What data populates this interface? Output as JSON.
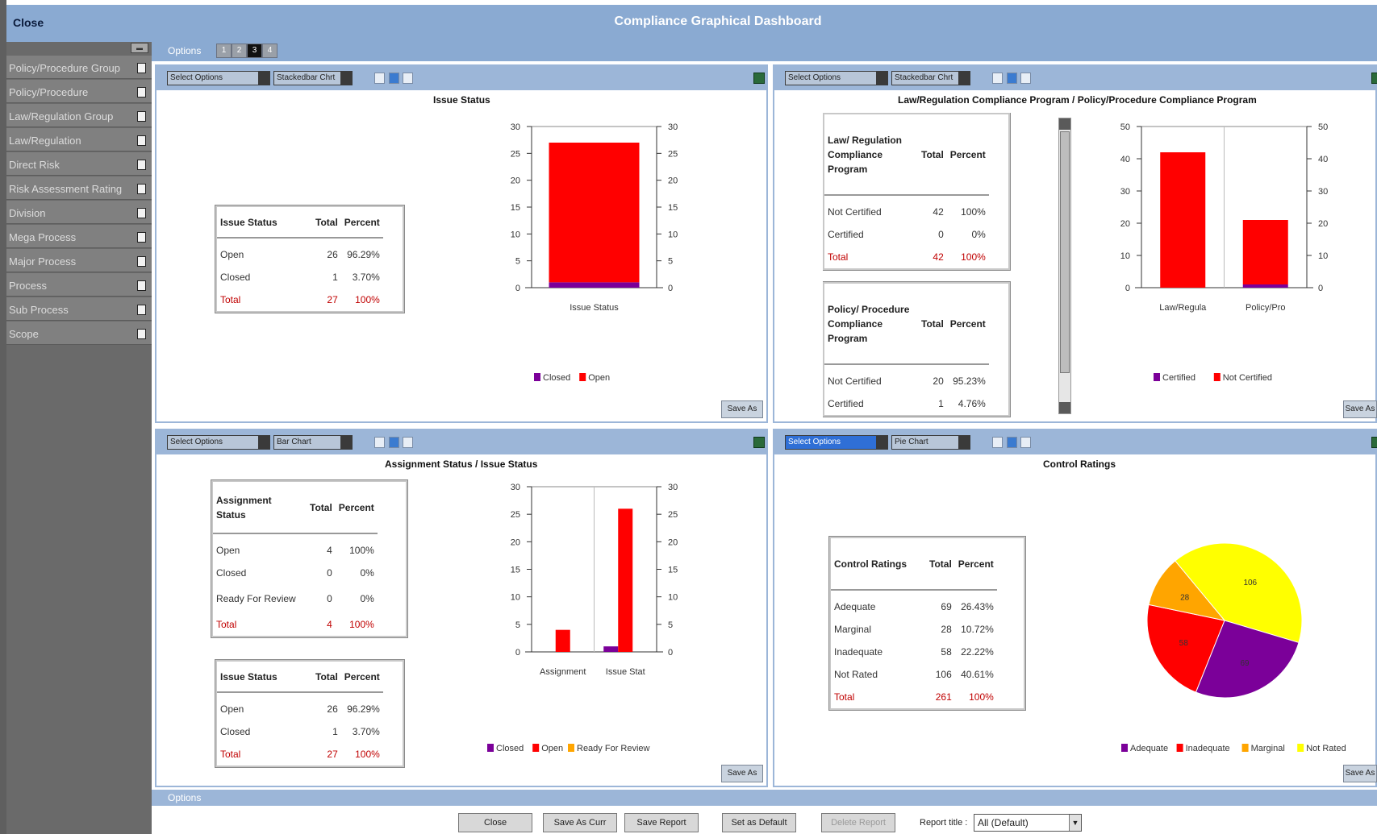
{
  "header": {
    "close_label": "Close",
    "title": "Compliance Graphical Dashboard",
    "options_label": "Options",
    "pages": [
      "1",
      "2",
      "3",
      "4"
    ],
    "active_page": "3"
  },
  "sidebar": {
    "items": [
      {
        "label": "Policy/Procedure Group"
      },
      {
        "label": "Policy/Procedure"
      },
      {
        "label": "Law/Regulation Group"
      },
      {
        "label": "Law/Regulation"
      },
      {
        "label": "Direct Risk"
      },
      {
        "label": "Risk Assessment Rating"
      },
      {
        "label": "Division"
      },
      {
        "label": "Mega Process"
      },
      {
        "label": "Major Process"
      },
      {
        "label": "Process"
      },
      {
        "label": "Sub Process"
      },
      {
        "label": "Scope"
      }
    ]
  },
  "panels": {
    "issue_status": {
      "select_options": "Select Options",
      "chart_type": "Stackedbar Chrt",
      "title": "Issue Status",
      "save_label": "Save As",
      "table": {
        "headers": [
          "Issue Status",
          "Total",
          "Percent"
        ],
        "rows": [
          [
            "Open",
            "26",
            "96.29%"
          ],
          [
            "Closed",
            "1",
            "3.70%"
          ]
        ],
        "total": [
          "Total",
          "27",
          "100%"
        ]
      }
    },
    "law_policy": {
      "select_options": "Select Options",
      "chart_type": "Stackedbar Chrt",
      "title": "Law/Regulation Compliance Program / Policy/Procedure Compliance Program",
      "save_label": "Save As",
      "table1": {
        "headers": [
          "Law/ Regulation Compliance Program",
          "Total",
          "Percent"
        ],
        "rows": [
          [
            "Not Certified",
            "42",
            "100%"
          ],
          [
            "Certified",
            "0",
            "0%"
          ]
        ],
        "total": [
          "Total",
          "42",
          "100%"
        ]
      },
      "table2": {
        "headers": [
          "Policy/ Procedure Compliance Program",
          "Total",
          "Percent"
        ],
        "rows": [
          [
            "Not Certified",
            "20",
            "95.23%"
          ],
          [
            "Certified",
            "1",
            "4.76%"
          ]
        ]
      }
    },
    "assignment": {
      "select_options": "Select Options",
      "chart_type": "Bar Chart",
      "title": "Assignment Status / Issue Status",
      "save_label": "Save As",
      "table1": {
        "headers": [
          "Assignment Status",
          "Total",
          "Percent"
        ],
        "rows": [
          [
            "Open",
            "4",
            "100%"
          ],
          [
            "Closed",
            "0",
            "0%"
          ],
          [
            "Ready For Review",
            "0",
            "0%"
          ]
        ],
        "total": [
          "Total",
          "4",
          "100%"
        ]
      },
      "table2": {
        "headers": [
          "Issue Status",
          "Total",
          "Percent"
        ],
        "rows": [
          [
            "Open",
            "26",
            "96.29%"
          ],
          [
            "Closed",
            "1",
            "3.70%"
          ]
        ],
        "total": [
          "Total",
          "27",
          "100%"
        ]
      }
    },
    "control": {
      "select_options": "Select Options",
      "chart_type": "Pie Chart",
      "title": "Control Ratings",
      "save_label": "Save As",
      "table": {
        "headers": [
          "Control Ratings",
          "Total",
          "Percent"
        ],
        "rows": [
          [
            "Adequate",
            "69",
            "26.43%"
          ],
          [
            "Marginal",
            "28",
            "10.72%"
          ],
          [
            "Inadequate",
            "58",
            "22.22%"
          ],
          [
            "Not Rated",
            "106",
            "40.61%"
          ]
        ],
        "total": [
          "Total",
          "261",
          "100%"
        ]
      }
    }
  },
  "footer": {
    "options_label": "Options",
    "buttons": [
      "Close",
      "Save As Curr",
      "Save Report",
      "Set as Default",
      "Delete Report"
    ],
    "report_title_label": "Report title :",
    "report_title_value": "All (Default)"
  },
  "colors": {
    "open": "#ff0000",
    "closed": "#7b0099",
    "ready_for_review": "#ffa500",
    "adequate": "#7b0099",
    "inadequate": "#ff0000",
    "marginal": "#ffa500",
    "not_rated": "#ffff00",
    "certified": "#7b0099",
    "not_certified": "#ff0000"
  },
  "chart_data": [
    {
      "id": "issue_status",
      "type": "bar",
      "stacked": true,
      "title": "Issue Status",
      "categories": [
        "Issue Status"
      ],
      "series": [
        {
          "name": "Closed",
          "color": "#7b0099",
          "values": [
            1
          ]
        },
        {
          "name": "Open",
          "color": "#ff0000",
          "values": [
            26
          ]
        }
      ],
      "ylim": [
        0,
        30
      ],
      "yticks": [
        "0",
        "5",
        "10",
        "15",
        "20",
        "25",
        "30"
      ],
      "legend": "bottom"
    },
    {
      "id": "law_policy",
      "type": "bar",
      "stacked": true,
      "title": "Law/Regulation Compliance Program / Policy/Procedure Compliance Program",
      "categories": [
        "Law/Regula",
        "Policy/Pro"
      ],
      "series": [
        {
          "name": "Certified",
          "color": "#7b0099",
          "values": [
            0,
            1
          ]
        },
        {
          "name": "Not Certified",
          "color": "#ff0000",
          "values": [
            42,
            20
          ]
        }
      ],
      "ylim": [
        0,
        50
      ],
      "yticks": [
        "0",
        "10",
        "20",
        "30",
        "40",
        "50"
      ],
      "legend": "bottom"
    },
    {
      "id": "assignment",
      "type": "bar",
      "stacked": false,
      "title": "Assignment Status / Issue Status",
      "categories": [
        "Assignment",
        "Issue Stat"
      ],
      "series": [
        {
          "name": "Closed",
          "color": "#7b0099",
          "values": [
            0,
            1
          ]
        },
        {
          "name": "Open",
          "color": "#ff0000",
          "values": [
            4,
            26
          ]
        },
        {
          "name": "Ready For Review",
          "color": "#ffa500",
          "values": [
            0,
            0
          ]
        }
      ],
      "ylim": [
        0,
        30
      ],
      "yticks": [
        "0",
        "5",
        "10",
        "15",
        "20",
        "25",
        "30"
      ],
      "legend": "bottom"
    },
    {
      "id": "control",
      "type": "pie",
      "title": "Control Ratings",
      "slices": [
        {
          "name": "Not Rated",
          "label": "106",
          "value": 106,
          "color": "#ffff00"
        },
        {
          "name": "Adequate",
          "label": "69",
          "value": 69,
          "color": "#7b0099"
        },
        {
          "name": "Inadequate",
          "label": "58",
          "value": 58,
          "color": "#ff0000"
        },
        {
          "name": "Marginal",
          "label": "28",
          "value": 28,
          "color": "#ffa500"
        }
      ],
      "legend_order": [
        "Adequate",
        "Inadequate",
        "Marginal",
        "Not Rated"
      ],
      "legend": "bottom"
    }
  ]
}
